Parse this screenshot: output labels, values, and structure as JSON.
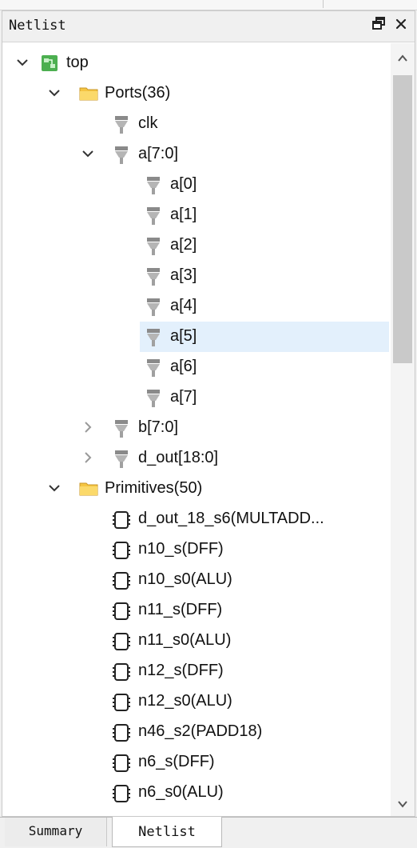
{
  "panel": {
    "title": "Netlist",
    "float_icon": "restore-window-icon",
    "close_icon": "close-icon"
  },
  "tree": {
    "root": {
      "label": "top",
      "icon": "module-icon",
      "expanded": true
    },
    "ports": {
      "label": "Ports(36)",
      "icon": "folder-icon",
      "expanded": true
    },
    "port_items": [
      {
        "label": "clk",
        "icon": "port-icon"
      },
      {
        "label": "a[7:0]",
        "icon": "port-icon",
        "expanded": true
      },
      {
        "label": "a[0]",
        "icon": "port-icon"
      },
      {
        "label": "a[1]",
        "icon": "port-icon"
      },
      {
        "label": "a[2]",
        "icon": "port-icon"
      },
      {
        "label": "a[3]",
        "icon": "port-icon"
      },
      {
        "label": "a[4]",
        "icon": "port-icon"
      },
      {
        "label": "a[5]",
        "icon": "port-icon",
        "selected": true
      },
      {
        "label": "a[6]",
        "icon": "port-icon"
      },
      {
        "label": "a[7]",
        "icon": "port-icon"
      },
      {
        "label": "b[7:0]",
        "icon": "port-icon",
        "expanded": false
      },
      {
        "label": "d_out[18:0]",
        "icon": "port-icon",
        "expanded": false
      }
    ],
    "primitives": {
      "label": "Primitives(50)",
      "icon": "folder-icon",
      "expanded": true
    },
    "primitive_items": [
      {
        "label": "d_out_18_s6(MULTADD..."
      },
      {
        "label": "n10_s(DFF)"
      },
      {
        "label": "n10_s0(ALU)"
      },
      {
        "label": "n11_s(DFF)"
      },
      {
        "label": "n11_s0(ALU)"
      },
      {
        "label": "n12_s(DFF)"
      },
      {
        "label": "n12_s0(ALU)"
      },
      {
        "label": "n46_s2(PADD18)"
      },
      {
        "label": "n6_s(DFF)"
      },
      {
        "label": "n6_s0(ALU)"
      }
    ]
  },
  "tabs": [
    {
      "label": "Summary",
      "active": false
    },
    {
      "label": "Netlist",
      "active": true
    }
  ],
  "colors": {
    "selection": "#e3f0fc",
    "folder": "#f5c542",
    "port": "#9a9a9a",
    "module": "#4caf50"
  }
}
